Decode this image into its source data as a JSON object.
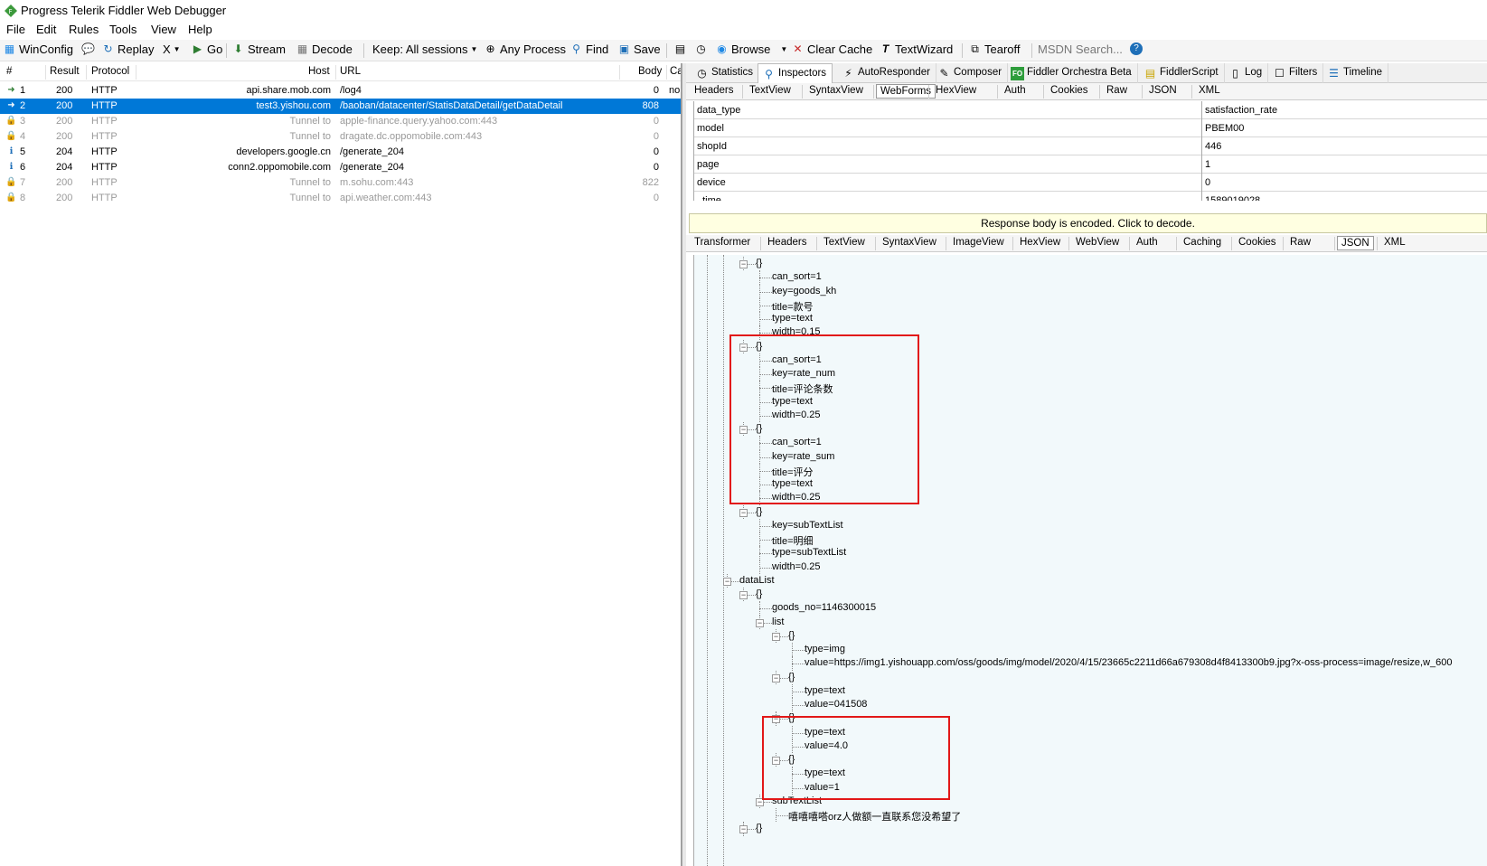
{
  "window": {
    "title": "Progress Telerik Fiddler Web Debugger"
  },
  "menu": [
    "File",
    "Edit",
    "Rules",
    "Tools",
    "View",
    "Help"
  ],
  "toolbar": {
    "winconfig": "WinConfig",
    "replay": "Replay",
    "remove": "X",
    "go": "Go",
    "stream": "Stream",
    "decode": "Decode",
    "keep": "Keep: All sessions",
    "process": "Any Process",
    "find": "Find",
    "save": "Save",
    "browse": "Browse",
    "clear_cache": "Clear Cache",
    "textwizard": "TextWizard",
    "tearoff": "Tearoff",
    "msdn_search": "MSDN Search..."
  },
  "sessions": {
    "columns": [
      "#",
      "Result",
      "Protocol",
      "Host",
      "URL",
      "Body",
      "Ca"
    ],
    "rows": [
      {
        "id": "1",
        "result": "200",
        "protocol": "HTTP",
        "host": "api.share.mob.com",
        "url": "/log4",
        "body": "0",
        "caching": "no",
        "icon": "arrow-icon",
        "state": "normal"
      },
      {
        "id": "2",
        "result": "200",
        "protocol": "HTTP",
        "host": "test3.yishou.com",
        "url": "/baoban/datacenter/StatisDataDetail/getDataDetail",
        "body": "808",
        "caching": "",
        "icon": "arrow-icon",
        "state": "selected"
      },
      {
        "id": "3",
        "result": "200",
        "protocol": "HTTP",
        "host": "Tunnel to",
        "url": "apple-finance.query.yahoo.com:443",
        "body": "0",
        "caching": "",
        "icon": "lock-icon",
        "state": "dim"
      },
      {
        "id": "4",
        "result": "200",
        "protocol": "HTTP",
        "host": "Tunnel to",
        "url": "dragate.dc.oppomobile.com:443",
        "body": "0",
        "caching": "",
        "icon": "lock-icon",
        "state": "dim"
      },
      {
        "id": "5",
        "result": "204",
        "protocol": "HTTP",
        "host": "developers.google.cn",
        "url": "/generate_204",
        "body": "0",
        "caching": "",
        "icon": "info-icon",
        "state": "normal"
      },
      {
        "id": "6",
        "result": "204",
        "protocol": "HTTP",
        "host": "conn2.oppomobile.com",
        "url": "/generate_204",
        "body": "0",
        "caching": "",
        "icon": "info-icon",
        "state": "normal"
      },
      {
        "id": "7",
        "result": "200",
        "protocol": "HTTP",
        "host": "Tunnel to",
        "url": "m.sohu.com:443",
        "body": "822",
        "caching": "",
        "icon": "lock-icon",
        "state": "dim"
      },
      {
        "id": "8",
        "result": "200",
        "protocol": "HTTP",
        "host": "Tunnel to",
        "url": "api.weather.com:443",
        "body": "0",
        "caching": "",
        "icon": "lock-icon",
        "state": "dim"
      }
    ]
  },
  "inspector_tabs": [
    "Statistics",
    "Inspectors",
    "AutoResponder",
    "Composer",
    "Fiddler Orchestra Beta",
    "FiddlerScript",
    "Log",
    "Filters",
    "Timeline"
  ],
  "request_tabs": [
    "Headers",
    "TextView",
    "SyntaxView",
    "WebForms",
    "HexView",
    "Auth",
    "Cookies",
    "Raw",
    "JSON",
    "XML"
  ],
  "request_active_tab": "WebForms",
  "webforms": [
    {
      "key": "data_type",
      "value": "satisfaction_rate"
    },
    {
      "key": "model",
      "value": "PBEM00"
    },
    {
      "key": "shopId",
      "value": "446"
    },
    {
      "key": "page",
      "value": "1"
    },
    {
      "key": "device",
      "value": "0"
    },
    {
      "key": "_time",
      "value": "1589019028"
    }
  ],
  "encoded_notice": "Response body is encoded. Click to decode.",
  "response_tabs": [
    "Transformer",
    "Headers",
    "TextView",
    "SyntaxView",
    "ImageView",
    "HexView",
    "WebView",
    "Auth",
    "Caching",
    "Cookies",
    "Raw",
    "JSON",
    "XML"
  ],
  "response_active_tab": "JSON",
  "tree_nodes": [
    {
      "text": "{}",
      "level": 1,
      "toggle": true
    },
    {
      "text": "can_sort=1",
      "level": 2
    },
    {
      "text": "key=goods_kh",
      "level": 2
    },
    {
      "text": "title=款号",
      "level": 2
    },
    {
      "text": "type=text",
      "level": 2
    },
    {
      "text": "width=0.15",
      "level": 2
    },
    {
      "text": "{}",
      "level": 1,
      "toggle": true
    },
    {
      "text": "can_sort=1",
      "level": 2
    },
    {
      "text": "key=rate_num",
      "level": 2
    },
    {
      "text": "title=评论条数",
      "level": 2
    },
    {
      "text": "type=text",
      "level": 2
    },
    {
      "text": "width=0.25",
      "level": 2
    },
    {
      "text": "{}",
      "level": 1,
      "toggle": true
    },
    {
      "text": "can_sort=1",
      "level": 2
    },
    {
      "text": "key=rate_sum",
      "level": 2
    },
    {
      "text": "title=评分",
      "level": 2
    },
    {
      "text": "type=text",
      "level": 2
    },
    {
      "text": "width=0.25",
      "level": 2
    },
    {
      "text": "{}",
      "level": 1,
      "toggle": true
    },
    {
      "text": "key=subTextList",
      "level": 2
    },
    {
      "text": "title=明细",
      "level": 2
    },
    {
      "text": "type=subTextList",
      "level": 2
    },
    {
      "text": "width=0.25",
      "level": 2
    },
    {
      "text": "dataList",
      "level": 0,
      "toggle": true
    },
    {
      "text": "{}",
      "level": 1,
      "toggle": true
    },
    {
      "text": "goods_no=1146300015",
      "level": 2
    },
    {
      "text": "list",
      "level": 2,
      "toggle": true
    },
    {
      "text": "{}",
      "level": 3,
      "toggle": true
    },
    {
      "text": "type=img",
      "level": 4
    },
    {
      "text": "value=https://img1.yishouapp.com/oss/goods/img/model/2020/4/15/23665c2211d66a679308d4f8413300b9.jpg?x-oss-process=image/resize,w_600",
      "level": 4
    },
    {
      "text": "{}",
      "level": 3,
      "toggle": true
    },
    {
      "text": "type=text",
      "level": 4
    },
    {
      "text": "value=041508",
      "level": 4
    },
    {
      "text": "{}",
      "level": 3,
      "toggle": true
    },
    {
      "text": "type=text",
      "level": 4
    },
    {
      "text": "value=4.0",
      "level": 4
    },
    {
      "text": "{}",
      "level": 3,
      "toggle": true
    },
    {
      "text": "type=text",
      "level": 4
    },
    {
      "text": "value=1",
      "level": 4
    },
    {
      "text": "subTextList",
      "level": 2,
      "toggle": true
    },
    {
      "text": "嘻嘻嘻嗒orz人做额一直联系您没希望了",
      "level": 3
    },
    {
      "text": "{}",
      "level": 1,
      "toggle": true
    }
  ],
  "colors": {
    "selection": "#0078d7",
    "highlight_box": "#e21818",
    "tree_bg": "#f2f9fb",
    "notice_bg": "#ffffe1"
  }
}
